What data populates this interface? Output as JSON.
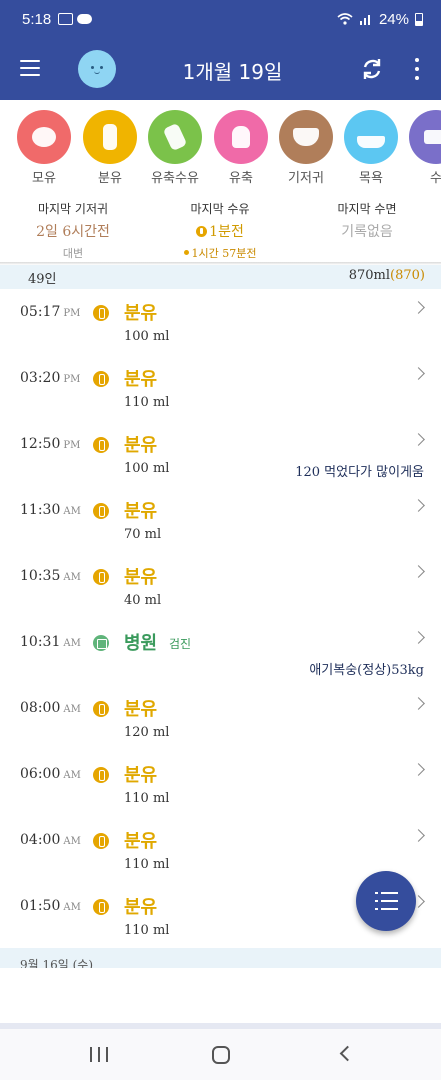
{
  "status_bar": {
    "time": "5:18",
    "battery": "24%"
  },
  "app_bar": {
    "title": "1개월 19일"
  },
  "categories": [
    {
      "label": "모유",
      "color": "#f06a6a",
      "icon": "breastfeeding-icon"
    },
    {
      "label": "분유",
      "color": "#f0b400",
      "icon": "bottle-icon"
    },
    {
      "label": "유축수유",
      "color": "#7bc24a",
      "icon": "pumped-bottle-icon"
    },
    {
      "label": "유축",
      "color": "#f06aa8",
      "icon": "breast-pump-icon"
    },
    {
      "label": "기저귀",
      "color": "#b07e5a",
      "icon": "diaper-icon"
    },
    {
      "label": "목욕",
      "color": "#5cc7f2",
      "icon": "bathtub-icon"
    },
    {
      "label": "수",
      "color": "#7a6fc9",
      "icon": "sleep-icon"
    }
  ],
  "summary": {
    "diaper": {
      "title": "마지막 기저귀",
      "value": "2일 6시간전",
      "sub": "대변"
    },
    "feeding": {
      "title": "마지막 수유",
      "value": "1분전",
      "sub": "1시간 57분전"
    },
    "sleep": {
      "title": "마지막 수면",
      "value": "기록없음"
    }
  },
  "day_header": {
    "left": "49인",
    "total": "870ml",
    "total_paren": "(870)"
  },
  "records": [
    {
      "time": "05:17",
      "ampm": "PM",
      "type": "분유",
      "kind": "feed",
      "amount": "100 ml",
      "memo": ""
    },
    {
      "time": "03:20",
      "ampm": "PM",
      "type": "분유",
      "kind": "feed",
      "amount": "110 ml",
      "memo": ""
    },
    {
      "time": "12:50",
      "ampm": "PM",
      "type": "분유",
      "kind": "feed",
      "amount": "100 ml",
      "memo": "120 먹었다가 많이게움"
    },
    {
      "time": "11:30",
      "ampm": "AM",
      "type": "분유",
      "kind": "feed",
      "amount": "70 ml",
      "memo": ""
    },
    {
      "time": "10:35",
      "ampm": "AM",
      "type": "분유",
      "kind": "feed",
      "amount": "40 ml",
      "memo": ""
    },
    {
      "time": "10:31",
      "ampm": "AM",
      "type": "병원",
      "kind": "hospital",
      "tag": "검진",
      "amount": "",
      "memo": "애기복숭(정상)53kg"
    },
    {
      "time": "08:00",
      "ampm": "AM",
      "type": "분유",
      "kind": "feed",
      "amount": "120 ml",
      "memo": ""
    },
    {
      "time": "06:00",
      "ampm": "AM",
      "type": "분유",
      "kind": "feed",
      "amount": "110 ml",
      "memo": ""
    },
    {
      "time": "04:00",
      "ampm": "AM",
      "type": "분유",
      "kind": "feed",
      "amount": "110 ml",
      "memo": ""
    },
    {
      "time": "01:50",
      "ampm": "AM",
      "type": "분유",
      "kind": "feed",
      "amount": "110 ml",
      "memo": ""
    }
  ],
  "next_day_header": "9월 16일 (수)"
}
